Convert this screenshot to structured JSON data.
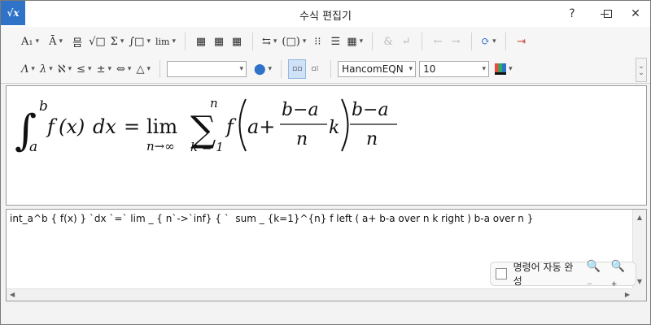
{
  "window": {
    "title": "수식 편집기",
    "app_icon_label": "√x",
    "help_label": "?",
    "minimize_label": "—",
    "maximize_label": "☐",
    "close_label": "✕"
  },
  "toolbar_row1": {
    "font_size_btn": "A₁",
    "accent_btn": "Ā",
    "frac_btn": "믐",
    "root_btn": "√□",
    "sum_btn": "Σ",
    "integral_btn": "∫□",
    "limit_btn": "lim",
    "matrix1_btn": "▦",
    "matrix2_btn": "▦",
    "matrix3_btn": "▦",
    "arrow_btn": "⇆",
    "paren_btn": "(□)",
    "matrix4_btn": "⁝⁝",
    "matrix5_btn": "☰",
    "matrix6_btn": "▦",
    "ampersand_btn": "&",
    "enter_btn": "↵",
    "back_btn": "←",
    "forward_btn": "→",
    "refresh_btn": "⟳",
    "exit_btn": "⇥"
  },
  "toolbar_row2": {
    "greek_upper_btn": "Λ",
    "greek_lower_btn": "λ",
    "notation_btn": "ℵ",
    "relation_btn": "≤",
    "operator_btn": "±",
    "arrow_sym_btn": "⇔",
    "misc_btn": "△",
    "history_value": "",
    "font_name_value": "HancomEQN",
    "font_size_value": "10",
    "color_label": "A"
  },
  "preview": {
    "integral": "∫",
    "lower": "a",
    "upper": "b",
    "f": "f",
    "x_paren": "(x)",
    "dx": "dx",
    "eq": "=",
    "lim": "lim",
    "lim_sub": "n→∞",
    "sum": "∑",
    "sum_top": "n",
    "sum_sub": "k = 1",
    "f2": "f",
    "a_plus": "a+",
    "frac1_num": "b−a",
    "frac1_den": "n",
    "k": "k",
    "frac2_num": "b−a",
    "frac2_den": "n"
  },
  "editor": {
    "script": "int_a^b { f(x) } `dx `=` lim _ { n`->`inf} { `  sum _ {k=1}^{n} f left ( a+ b-a over n k right ) b-a over n }"
  },
  "autocomplete": {
    "label": "명령어 자동 완성",
    "zoom_out": "−",
    "zoom_in": "+"
  },
  "colors": {
    "accent": "#2f73c8",
    "exit_red": "#c0392b",
    "refresh_blue": "#2f73c8"
  }
}
